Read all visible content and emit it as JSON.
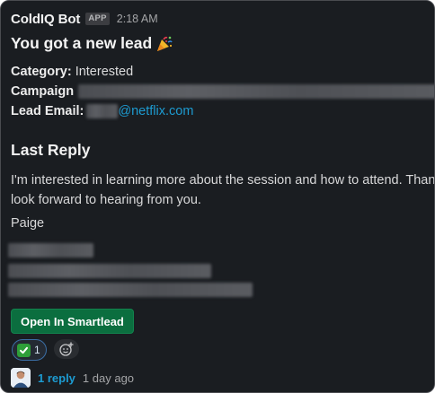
{
  "message": {
    "bot_name": "ColdIQ Bot",
    "app_badge": "APP",
    "timestamp": "2:18 AM",
    "title": "You got a new lead",
    "title_emoji": "party-popper-icon",
    "fields": {
      "category_label": "Category:",
      "category_value": "Interested",
      "campaign_label": "Campaign",
      "lead_email_label": "Lead Email:",
      "lead_email_domain": "@netflix.com"
    },
    "last_reply": {
      "heading": "Last Reply",
      "body": "I'm interested in learning more about the session and how to attend. Thank you, I look forward to hearing from you.",
      "signature_name": "Paige"
    },
    "cta_label": "Open In Smartlead",
    "reactions": [
      {
        "icon": "check-mark-icon",
        "count": "1"
      }
    ],
    "thread": {
      "reply_count": "1 reply",
      "last_reply_time": "1 day ago"
    }
  },
  "colors": {
    "background": "#1a1d21",
    "link": "#1d9bd1",
    "button": "#0b6e3f",
    "reaction_border": "#3b6ea5"
  }
}
